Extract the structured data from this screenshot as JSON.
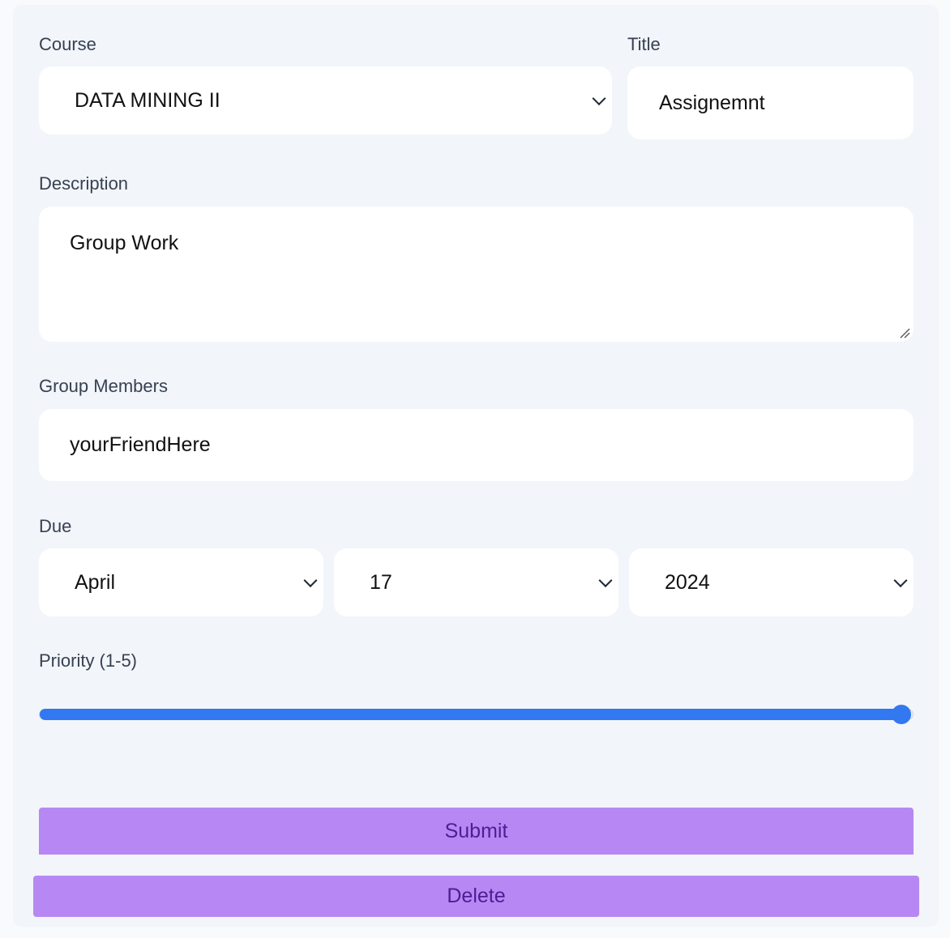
{
  "form": {
    "course_label": "Course",
    "course_value": "DATA MINING II",
    "title_label": "Title",
    "title_value": "Assignemnt",
    "description_label": "Description",
    "description_value": "Group Work",
    "members_label": "Group Members",
    "members_value": "yourFriendHere",
    "due_label": "Due",
    "due_month": "April",
    "due_day": "17",
    "due_year": "2024",
    "priority_label": "Priority (1-5)",
    "priority_value": 5,
    "priority_min": 1,
    "priority_max": 5,
    "submit_label": "Submit",
    "delete_label": "Delete"
  },
  "colors": {
    "accent": "#3278f0",
    "button": "#b788f3",
    "button_text": "#4c1d95"
  },
  "icons": {
    "select_arrow": "chevron-down-icon",
    "resize_handle": "resize-handle-icon"
  }
}
